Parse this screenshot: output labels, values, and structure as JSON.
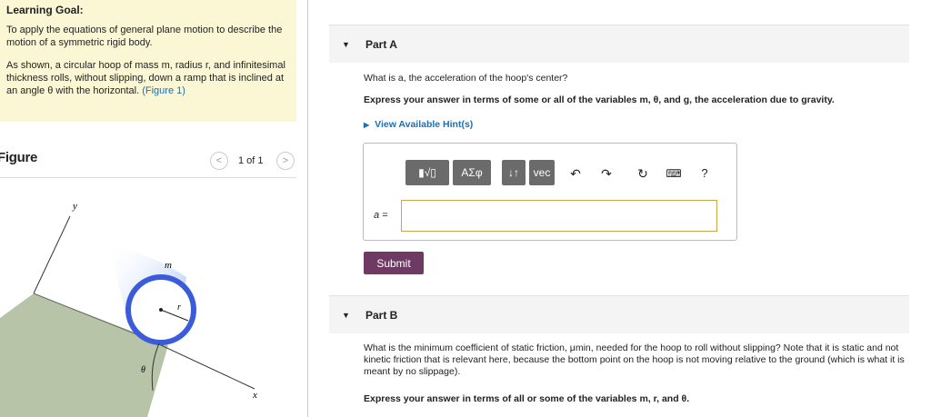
{
  "learning_goal": {
    "title": "Learning Goal:",
    "para1": "To apply the equations of general plane motion to describe the motion of a symmetric rigid body.",
    "para2": "As shown, a circular hoop of mass m, radius r, and infinitesimal thickness rolls, without slipping, down a ramp that is inclined at an angle θ with the horizontal.",
    "figure_link": "(Figure 1)"
  },
  "figure": {
    "title": "Figure",
    "counter": "1 of 1",
    "prev_icon": "chevron-left-icon",
    "next_icon": "chevron-right-icon",
    "labels": {
      "y": "y",
      "x": "x",
      "m": "m",
      "r": "r",
      "theta": "θ"
    },
    "colors": {
      "ramp": "#b8c4a8",
      "hoop": "#3b5bdb",
      "blur": "#78a4f0"
    }
  },
  "part_a": {
    "label": "Part A",
    "question": "What is a, the acceleration of the hoop's center?",
    "instruction": "Express your answer in terms of some or all of the variables m, θ, and g, the acceleration due to gravity.",
    "hint_link": "View Available Hint(s)",
    "toolbar": {
      "templates": "▮√▯",
      "greek": "ΑΣφ",
      "arrows": "↓↑",
      "vec": "vec",
      "undo_icon": "undo-icon",
      "redo_icon": "redo-icon",
      "reset_icon": "reset-icon",
      "keyboard_icon": "keyboard-icon",
      "help": "?"
    },
    "answer_label": "a =",
    "answer_value": "",
    "submit": "Submit"
  },
  "part_b": {
    "label": "Part B",
    "question": "What is the minimum coefficient of static friction, μmin, needed for the hoop to roll without slipping? Note that it is static and not kinetic friction that is relevant here, because the bottom point on the hoop is not moving relative to the ground (which is what it is meant by no slippage).",
    "instruction": "Express your answer in terms of all or some of the variables m, r, and θ."
  },
  "colors": {
    "accent": "#1a6fb5",
    "submit": "#6e3a63",
    "goal_bg": "#fbf7d4"
  }
}
